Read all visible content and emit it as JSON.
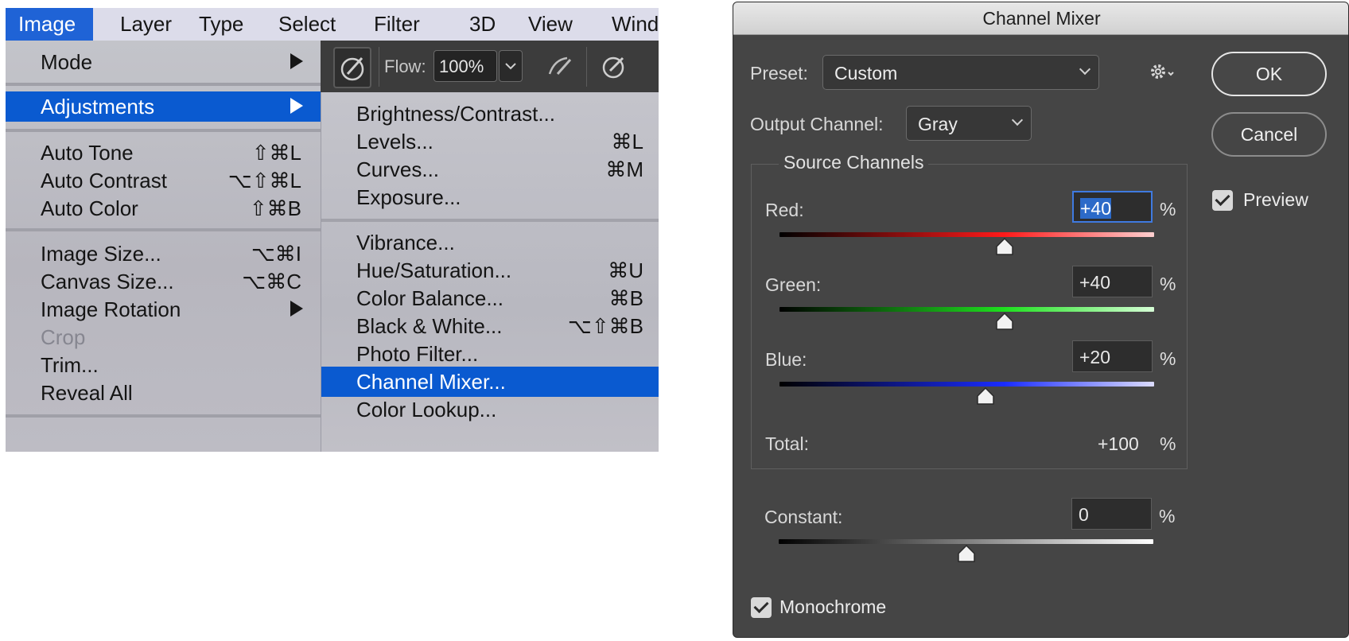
{
  "menubar": {
    "items": [
      "Image",
      "Layer",
      "Type",
      "Select",
      "Filter",
      "3D",
      "View",
      "Windo"
    ],
    "active_index": 0
  },
  "image_menu": {
    "items": [
      {
        "label": "Mode",
        "submenu": true
      },
      {
        "label": "Adjustments",
        "submenu": true,
        "selected": true
      },
      {
        "label": "Auto Tone",
        "shortcut": "⇧⌘L"
      },
      {
        "label": "Auto Contrast",
        "shortcut": "⌥⇧⌘L"
      },
      {
        "label": "Auto Color",
        "shortcut": "⇧⌘B"
      },
      {
        "label": "Image Size...",
        "shortcut": "⌥⌘I"
      },
      {
        "label": "Canvas Size...",
        "shortcut": "⌥⌘C"
      },
      {
        "label": "Image Rotation",
        "submenu": true
      },
      {
        "label": "Crop",
        "disabled": true
      },
      {
        "label": "Trim..."
      },
      {
        "label": "Reveal All"
      }
    ]
  },
  "toolbar": {
    "flow_label": "Flow:",
    "flow_value": "100%",
    "icons": [
      "brush-settings-icon",
      "airbrush-icon",
      "pressure-flow-icon"
    ]
  },
  "adjustments_menu": {
    "items": [
      {
        "label": "Brightness/Contrast..."
      },
      {
        "label": "Levels...",
        "shortcut": "⌘L"
      },
      {
        "label": "Curves...",
        "shortcut": "⌘M"
      },
      {
        "label": "Exposure..."
      },
      {
        "label": "Vibrance..."
      },
      {
        "label": "Hue/Saturation...",
        "shortcut": "⌘U"
      },
      {
        "label": "Color Balance...",
        "shortcut": "⌘B"
      },
      {
        "label": "Black & White...",
        "shortcut": "⌥⇧⌘B"
      },
      {
        "label": "Photo Filter..."
      },
      {
        "label": "Channel Mixer...",
        "selected": true
      },
      {
        "label": "Color Lookup..."
      }
    ]
  },
  "dialog": {
    "title": "Channel Mixer",
    "preset_label": "Preset:",
    "preset_value": "Custom",
    "output_channel_label": "Output Channel:",
    "output_channel_value": "Gray",
    "ok_label": "OK",
    "cancel_label": "Cancel",
    "preview_label": "Preview",
    "preview_checked": true,
    "source_channels_title": "Source Channels",
    "channels": [
      {
        "label": "Red:",
        "value": "+40",
        "unit": "%",
        "amount": 40,
        "focused": true,
        "color": "#ff1a1a"
      },
      {
        "label": "Green:",
        "value": "+40",
        "unit": "%",
        "amount": 40,
        "color": "#1ee01e"
      },
      {
        "label": "Blue:",
        "value": "+20",
        "unit": "%",
        "amount": 20,
        "color": "#1a2cff"
      }
    ],
    "total_label": "Total:",
    "total_value": "+100",
    "total_unit": "%",
    "constant_label": "Constant:",
    "constant_value": "0",
    "constant_unit": "%",
    "constant_amount": 0,
    "monochrome_label": "Monochrome",
    "monochrome_checked": true
  }
}
